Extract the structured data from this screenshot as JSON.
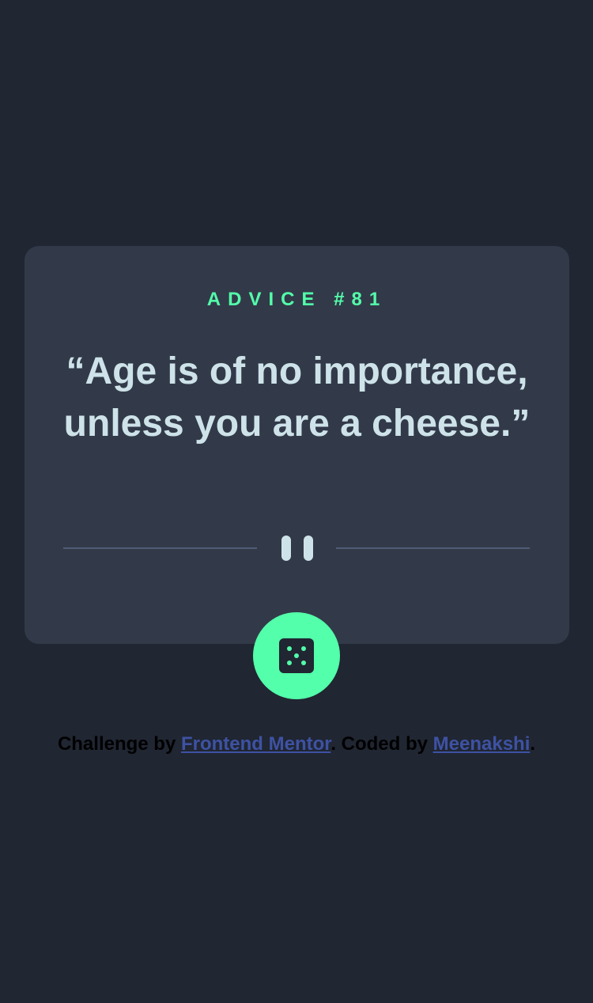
{
  "card": {
    "advice_label": "ADVICE #81",
    "advice_text": "“Age is of no importance, unless you are a cheese.”"
  },
  "dice_button": {
    "icon": "dice-icon"
  },
  "footer": {
    "prefix": "Challenge by ",
    "link1": "Frontend Mentor",
    "middle": ". Coded by ",
    "link2": "Meenakshi",
    "suffix": "."
  },
  "colors": {
    "background": "#202632",
    "card": "#323A49",
    "accent": "#53FFAA",
    "text": "#CEE3E9",
    "divider": "#4F5D74",
    "link": "#3E52A3"
  }
}
